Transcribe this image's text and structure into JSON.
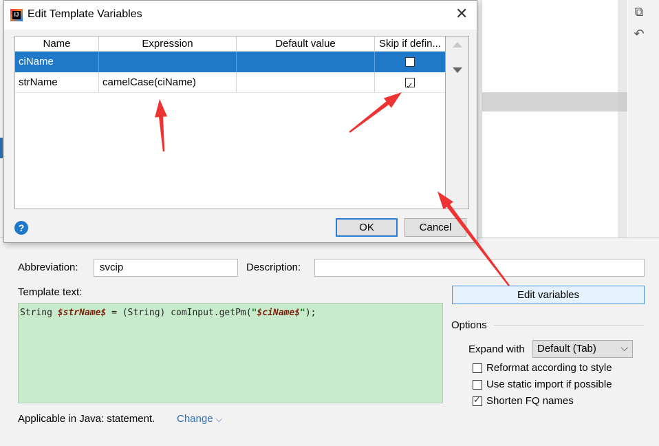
{
  "dialog": {
    "title": "Edit Template Variables",
    "close_symbol": "✕",
    "app_icon": "intellij-idea-icon",
    "app_icon_text": "IJ",
    "columns": [
      "Name",
      "Expression",
      "Default value",
      "Skip if defin..."
    ],
    "rows": [
      {
        "name": "ciName",
        "expression": "",
        "default_value": "",
        "skip_if_defined": false,
        "selected": true
      },
      {
        "name": "strName",
        "expression": "camelCase(ciName)",
        "default_value": "",
        "skip_if_defined": true,
        "selected": false
      }
    ],
    "help_label": "?",
    "ok_label": "OK",
    "cancel_label": "Cancel"
  },
  "editor": {
    "abbreviation_label": "Abbreviation:",
    "abbreviation_value": "svcip",
    "description_label": "Description:",
    "description_value": "",
    "template_text_label": "Template text:",
    "template_code": {
      "p1": "String ",
      "v1": "$strName$",
      "p2": " = (String) comInput.getPm(",
      "s1": "\"",
      "v2": "$ciName$",
      "s2": "\"",
      "p3": ");"
    },
    "edit_variables_label": "Edit variables",
    "applicable_label": "Applicable in Java: statement.",
    "change_label": "Change",
    "change_icon": "chevron-down-icon"
  },
  "options": {
    "title": "Options",
    "expand_with_label": "Expand with",
    "expand_with_value": "Default (Tab)",
    "checkboxes": [
      {
        "label": "Reformat according to style",
        "checked": false
      },
      {
        "label": "Use static import if possible",
        "checked": false
      },
      {
        "label": "Shorten FQ names",
        "checked": true
      }
    ]
  },
  "colors": {
    "selection": "#1f78c8",
    "template_bg": "#c8eccb",
    "annotation_arrow": "#ee3333"
  }
}
